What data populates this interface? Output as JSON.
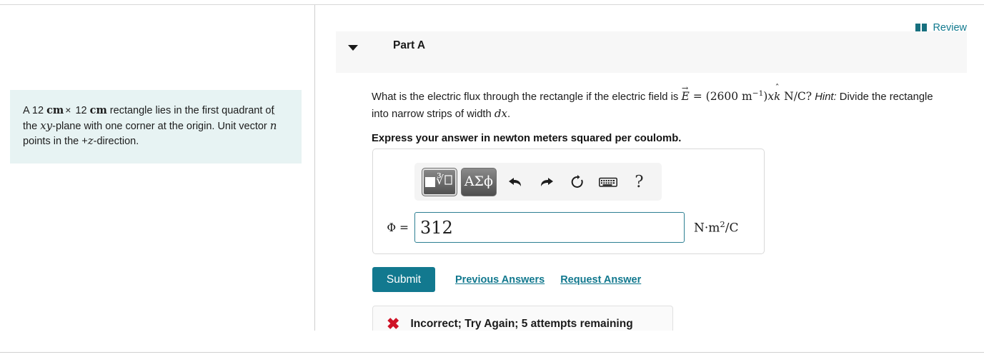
{
  "problem": {
    "text_parts": {
      "a": "A 12 ",
      "cm1": "cm",
      "times": "×",
      "b": " 12 ",
      "cm2": "cm",
      "c": " rectangle lies in the first quadrant of the ",
      "xy": "xy",
      "d": "-plane with one corner at the origin. Unit vector ",
      "nhat_base": "n",
      "nhat_accent": "ˆ",
      "e": " points in the +",
      "z": "z",
      "f": "-direction."
    }
  },
  "review": {
    "label": "Review",
    "icon": "book-icon"
  },
  "part": {
    "title": "Part A",
    "caret_icon": "chevron-down-icon"
  },
  "question": {
    "seg1": "What is the electric flux through the rectangle if the electric field is ",
    "E_symbol": "E",
    "E_arrow": "→",
    "eq": "=",
    "coefficient": "(2600 m",
    "exponent": "−1",
    "coefficient_tail": ")",
    "x_var": "x",
    "k_base": "k",
    "k_accent": "ˆ",
    "units_inline": "N/C?",
    "hint_label": "Hint:",
    "seg2": " Divide the rectangle into narrow strips of width ",
    "dx": "dx",
    "period": ".",
    "express": "Express your answer in newton meters squared per coulomb."
  },
  "toolbar": {
    "template_button_label": "√",
    "template_icon": "math-template-icon",
    "greek_button_label": "ΑΣϕ",
    "greek_icon": "greek-letters-icon",
    "undo_icon": "undo-arrow-icon",
    "redo_icon": "redo-arrow-icon",
    "reset_icon": "reset-circular-arrow-icon",
    "keyboard_icon": "keyboard-icon",
    "help_label": "?",
    "help_icon": "question-mark-icon"
  },
  "answer": {
    "label": "Φ =",
    "value": "312",
    "placeholder": "",
    "units_n": "N",
    "units_dot": "·",
    "units_m": "m",
    "units_exp": "2",
    "units_tail": "/C"
  },
  "actions": {
    "submit_label": "Submit",
    "previous_answers_label": "Previous Answers",
    "request_answer_label": "Request Answer"
  },
  "feedback": {
    "icon": "red-x-icon",
    "mark": "✖",
    "message": "Incorrect; Try Again; 5 attempts remaining"
  },
  "colors": {
    "accent_teal": "#12798f",
    "link_teal": "#11788e",
    "info_box_bg": "#e7f3f3",
    "header_band_bg": "#f7f7f7",
    "error_red": "#cf1226",
    "input_border": "#2d7f92"
  }
}
